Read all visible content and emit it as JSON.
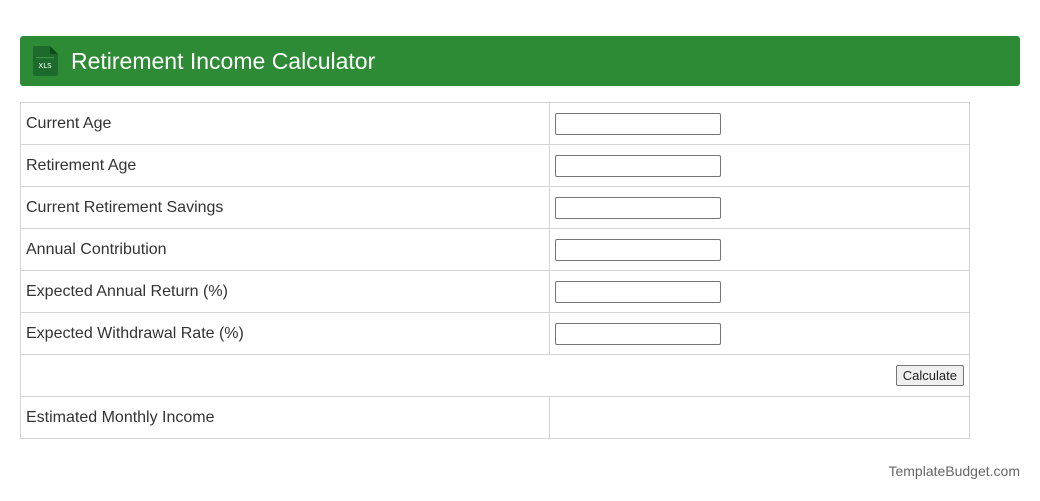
{
  "header": {
    "icon_name": "xls-file-icon",
    "icon_text": "XLS",
    "title": "Retirement Income Calculator",
    "bg_color": "#2e8b35"
  },
  "form": {
    "rows": [
      {
        "label": "Current Age",
        "value": ""
      },
      {
        "label": "Retirement Age",
        "value": ""
      },
      {
        "label": "Current Retirement Savings",
        "value": ""
      },
      {
        "label": "Annual Contribution",
        "value": ""
      },
      {
        "label": "Expected Annual Return (%)",
        "value": ""
      },
      {
        "label": "Expected Withdrawal Rate (%)",
        "value": ""
      }
    ],
    "calculate_label": "Calculate",
    "result_label": "Estimated Monthly Income",
    "result_value": ""
  },
  "footer": {
    "credit": "TemplateBudget.com"
  }
}
